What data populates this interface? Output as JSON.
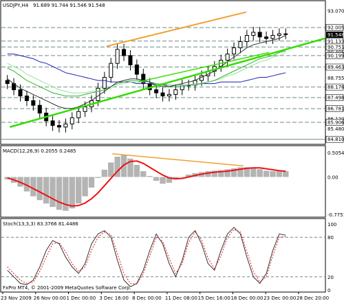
{
  "chart_data": {
    "type": "line",
    "symbol": "USDJPY,H4",
    "ohlc_header": "91.689 91.744 91.546 91.548",
    "copyright": "FxPro MT4, © 2001-2009 MetaQuotes Software Corp.",
    "x_labels": [
      "23 Nov 2009",
      "26 Nov 00:00",
      "1 Dec 00:00",
      "3 Dec 16:00",
      "8 Dec 00:00",
      "11 Dec 08:00",
      "15 Dec 16:00",
      "18 Dec 00:00",
      "23 Dec 00:00",
      "28 Dec 20:00"
    ],
    "price_panel": {
      "ylim": [
        84.71,
        93.07
      ],
      "labels": [
        "93.070",
        "92.005",
        "91.133",
        "90.751",
        "90.405",
        "90.199",
        "89.463",
        "88.755",
        "88.176",
        "87.498",
        "86.781",
        "86.120",
        "85.906",
        "85.480",
        "84.810"
      ],
      "boxed_labels": [
        "92.005",
        "91.548",
        "91.133",
        "90.751",
        "90.199",
        "89.463",
        "88.176",
        "87.498",
        "86.781",
        "85.906",
        "84.810"
      ],
      "dashed_levels": [
        92.005,
        91.133,
        90.751,
        90.199,
        89.463,
        88.176,
        87.498,
        86.781,
        85.906
      ],
      "close": [
        88.4,
        88.0,
        87.6,
        87.3,
        87.0,
        86.5,
        86.0,
        85.7,
        85.6,
        85.8,
        86.2,
        86.6,
        86.9,
        87.3,
        88.1,
        88.8,
        89.7,
        90.6,
        90.2,
        89.6,
        89.0,
        88.4,
        88.0,
        87.8,
        87.6,
        87.7,
        88.0,
        88.3,
        88.3,
        88.6,
        88.9,
        89.2,
        89.5,
        89.9,
        90.3,
        90.7,
        91.1,
        91.5,
        91.7,
        91.4,
        91.3,
        91.5,
        91.6,
        91.6
      ],
      "ma_black": [
        88.7,
        88.4,
        88.1,
        87.9,
        87.7,
        87.5,
        87.3,
        87.1,
        86.9,
        86.8,
        86.8,
        86.9,
        87.1,
        87.3,
        87.6,
        87.9,
        88.2,
        88.5,
        88.6,
        88.7,
        88.7,
        88.6,
        88.5,
        88.3,
        88.2,
        88.2,
        88.3,
        88.4,
        88.5,
        88.6,
        88.8,
        89.0,
        89.2,
        89.5,
        89.8,
        90.1,
        90.4,
        90.7,
        90.9,
        91.0,
        91.1,
        91.2,
        91.3,
        91.5
      ],
      "ma_green": [
        89.4,
        89.2,
        88.9,
        88.6,
        88.4,
        88.2,
        88.0,
        87.8,
        87.7,
        87.6,
        87.6,
        87.6,
        87.7,
        87.8,
        87.9,
        88.0,
        88.2,
        88.4,
        88.5,
        88.6,
        88.6,
        88.6,
        88.5,
        88.4,
        88.3,
        88.2,
        88.2,
        88.2,
        88.3,
        88.3,
        88.4,
        88.5,
        88.6,
        88.8,
        89.0,
        89.2,
        89.4,
        89.6,
        89.8,
        90.0,
        90.1,
        90.2,
        90.4,
        90.5
      ],
      "ma_lightgreen": [
        89.7,
        89.5,
        89.3,
        89.0,
        88.8,
        88.6,
        88.4,
        88.2,
        88.0,
        87.9,
        87.8,
        87.8,
        87.8,
        87.9,
        87.9,
        88.0,
        88.1,
        88.3,
        88.4,
        88.5,
        88.5,
        88.5,
        88.5,
        88.4,
        88.4,
        88.3,
        88.3,
        88.3,
        88.3,
        88.4,
        88.4,
        88.5,
        88.6,
        88.7,
        88.9,
        89.0,
        89.2,
        89.4,
        89.6,
        89.8,
        89.9,
        90.1,
        90.2,
        90.4
      ],
      "ma_blue": [
        90.3,
        90.3,
        90.2,
        90.1,
        90.0,
        89.8,
        89.7,
        89.5,
        89.3,
        89.1,
        89.0,
        88.9,
        88.8,
        88.7,
        88.6,
        88.6,
        88.5,
        88.5,
        88.5,
        88.5,
        88.4,
        88.4,
        88.4,
        88.3,
        88.3,
        88.3,
        88.3,
        88.3,
        88.3,
        88.4,
        88.4,
        88.4,
        88.4,
        88.5,
        88.5,
        88.5,
        88.5,
        88.6,
        88.7,
        88.8,
        88.8,
        88.9,
        89.0,
        89.1
      ],
      "trend_up_green": {
        "from": [
          0.02,
          85.6
        ],
        "to": [
          1.0,
          91.3
        ]
      },
      "trend_up_green2": {
        "from": [
          0.47,
          88.5
        ],
        "to": [
          0.93,
          90.4
        ]
      },
      "resistance_orange": {
        "from": [
          0.36,
          90.8
        ],
        "to": [
          0.85,
          93.0
        ]
      },
      "colors": {
        "candles": "#000000",
        "ma_black": "#333333",
        "ma_green": "#2db52d",
        "ma_lightgreen": "#9be09b",
        "ma_blue": "#1c1cb4",
        "trend": "#33dd00",
        "resistance": "#f0a030",
        "last_price_bg": "#000000",
        "grid": "#6e8a8a"
      }
    },
    "macd_panel": {
      "header": "MACD(12,26,9) 0.2055 0.2485",
      "ylim": [
        -0.7751,
        0.5054
      ],
      "labels": [
        "0.5054",
        "0.00",
        "-0.7751"
      ],
      "histogram": [
        -0.05,
        -0.12,
        -0.2,
        -0.3,
        -0.4,
        -0.48,
        -0.55,
        -0.62,
        -0.68,
        -0.7,
        -0.65,
        -0.55,
        -0.4,
        -0.22,
        -0.02,
        0.15,
        0.3,
        0.42,
        0.46,
        0.38,
        0.25,
        0.12,
        0.02,
        -0.08,
        -0.14,
        -0.12,
        -0.05,
        0.0,
        0.05,
        0.08,
        0.1,
        0.12,
        0.13,
        0.14,
        0.16,
        0.18,
        0.2,
        0.2,
        0.19,
        0.16,
        0.13,
        0.12,
        0.12,
        0.12
      ],
      "signal": [
        -0.02,
        -0.06,
        -0.11,
        -0.17,
        -0.24,
        -0.31,
        -0.38,
        -0.45,
        -0.52,
        -0.57,
        -0.6,
        -0.59,
        -0.54,
        -0.45,
        -0.33,
        -0.18,
        -0.03,
        0.12,
        0.25,
        0.32,
        0.33,
        0.28,
        0.2,
        0.12,
        0.04,
        -0.02,
        -0.04,
        -0.03,
        0.0,
        0.03,
        0.06,
        0.08,
        0.1,
        0.11,
        0.12,
        0.14,
        0.16,
        0.18,
        0.19,
        0.19,
        0.17,
        0.15,
        0.13,
        0.12
      ],
      "divergence_line": {
        "from": [
          0.38,
          0.48
        ],
        "to": [
          0.84,
          0.23
        ]
      },
      "colors": {
        "histogram": "#b4b4b4",
        "signal": "#ee1111",
        "divergence": "#f0a030"
      }
    },
    "stoch_panel": {
      "header": "Stoch(13,3,3) 83.3766 81.4486",
      "ylim": [
        0,
        100
      ],
      "labels": [
        "100",
        "80",
        "20",
        "0"
      ],
      "main": [
        30,
        20,
        10,
        8,
        15,
        35,
        60,
        75,
        70,
        50,
        35,
        25,
        40,
        70,
        85,
        90,
        80,
        45,
        15,
        5,
        10,
        30,
        60,
        85,
        70,
        40,
        20,
        45,
        80,
        90,
        70,
        40,
        30,
        60,
        85,
        95,
        85,
        50,
        20,
        10,
        25,
        60,
        85,
        83
      ],
      "signal": [
        35,
        25,
        15,
        10,
        12,
        28,
        50,
        70,
        72,
        58,
        40,
        28,
        35,
        60,
        80,
        88,
        84,
        55,
        25,
        10,
        9,
        25,
        52,
        80,
        74,
        48,
        25,
        40,
        72,
        88,
        76,
        48,
        32,
        52,
        80,
        92,
        88,
        58,
        28,
        12,
        20,
        52,
        80,
        81
      ],
      "colors": {
        "main": "#333333",
        "signal": "#ee1111",
        "grid": "#6e8a8a"
      }
    }
  }
}
